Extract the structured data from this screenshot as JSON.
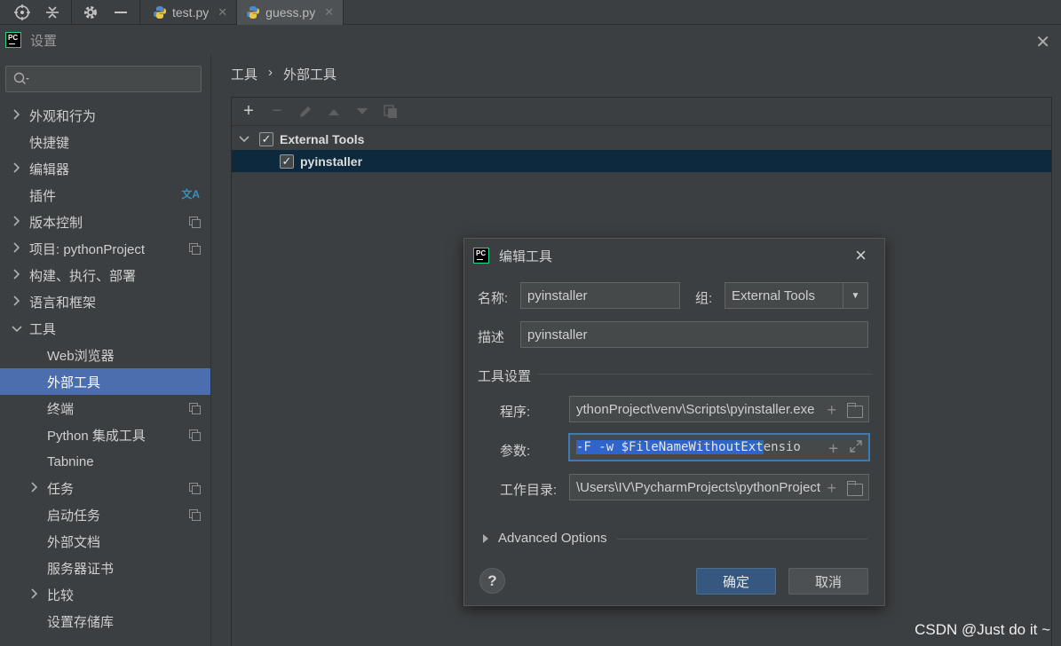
{
  "topbar": {
    "tabs": [
      {
        "label": "test.py",
        "active": false
      },
      {
        "label": "guess.py",
        "active": true
      }
    ],
    "icons": [
      "crosshair-icon",
      "collapse-icon",
      "gear-icon",
      "minimize-icon"
    ]
  },
  "settings": {
    "title": "设置",
    "search_placeholder": "Q▾",
    "tree": [
      {
        "label": "外观和行为",
        "expandable": true,
        "expanded": false,
        "indent": 0
      },
      {
        "label": "快捷键",
        "expandable": false,
        "indent": 0
      },
      {
        "label": "编辑器",
        "expandable": true,
        "expanded": false,
        "indent": 0
      },
      {
        "label": "插件",
        "expandable": false,
        "indent": 0,
        "icon": "translate-icon"
      },
      {
        "label": "版本控制",
        "expandable": true,
        "expanded": false,
        "indent": 0,
        "icon": "copy-icon"
      },
      {
        "label": "项目: pythonProject",
        "expandable": true,
        "expanded": false,
        "indent": 0,
        "icon": "copy-icon"
      },
      {
        "label": "构建、执行、部署",
        "expandable": true,
        "expanded": false,
        "indent": 0
      },
      {
        "label": "语言和框架",
        "expandable": true,
        "expanded": false,
        "indent": 0
      },
      {
        "label": "工具",
        "expandable": true,
        "expanded": true,
        "indent": 0
      },
      {
        "label": "Web浏览器",
        "expandable": false,
        "indent": 1
      },
      {
        "label": "外部工具",
        "expandable": false,
        "indent": 1,
        "selected": true
      },
      {
        "label": "终端",
        "expandable": false,
        "indent": 1,
        "icon": "copy-icon"
      },
      {
        "label": "Python 集成工具",
        "expandable": false,
        "indent": 1,
        "icon": "copy-icon"
      },
      {
        "label": "Tabnine",
        "expandable": false,
        "indent": 1
      },
      {
        "label": "任务",
        "expandable": true,
        "expanded": false,
        "indent": 1,
        "icon": "copy-icon"
      },
      {
        "label": "启动任务",
        "expandable": false,
        "indent": 1,
        "icon": "copy-icon"
      },
      {
        "label": "外部文档",
        "expandable": false,
        "indent": 1
      },
      {
        "label": "服务器证书",
        "expandable": false,
        "indent": 1
      },
      {
        "label": "比较",
        "expandable": true,
        "expanded": false,
        "indent": 1
      },
      {
        "label": "设置存储库",
        "expandable": false,
        "indent": 1
      }
    ],
    "breadcrumb": [
      "工具",
      "›",
      "外部工具"
    ],
    "tools_tree": {
      "group": "External Tools",
      "group_checked": true,
      "item": "pyinstaller",
      "item_checked": true
    }
  },
  "edit_dialog": {
    "title": "编辑工具",
    "name_label": "名称:",
    "name_value": "pyinstaller",
    "group_label": "组:",
    "group_value": "External Tools",
    "desc_label": "描述",
    "desc_value": "pyinstaller",
    "section_label": "工具设置",
    "program_label": "程序:",
    "program_value": "ythonProject\\venv\\Scripts\\pyinstaller.exe",
    "args_label": "参数:",
    "args_selected": "-F -w $FileNameWithoutExt",
    "args_rest": "ensio",
    "workdir_label": "工作目录:",
    "workdir_value": "\\Users\\IV\\PycharmProjects\\pythonProject",
    "advanced_label": "Advanced Options",
    "ok_label": "确定",
    "cancel_label": "取消",
    "help_label": "?"
  },
  "watermark": "CSDN @Just do it ~"
}
